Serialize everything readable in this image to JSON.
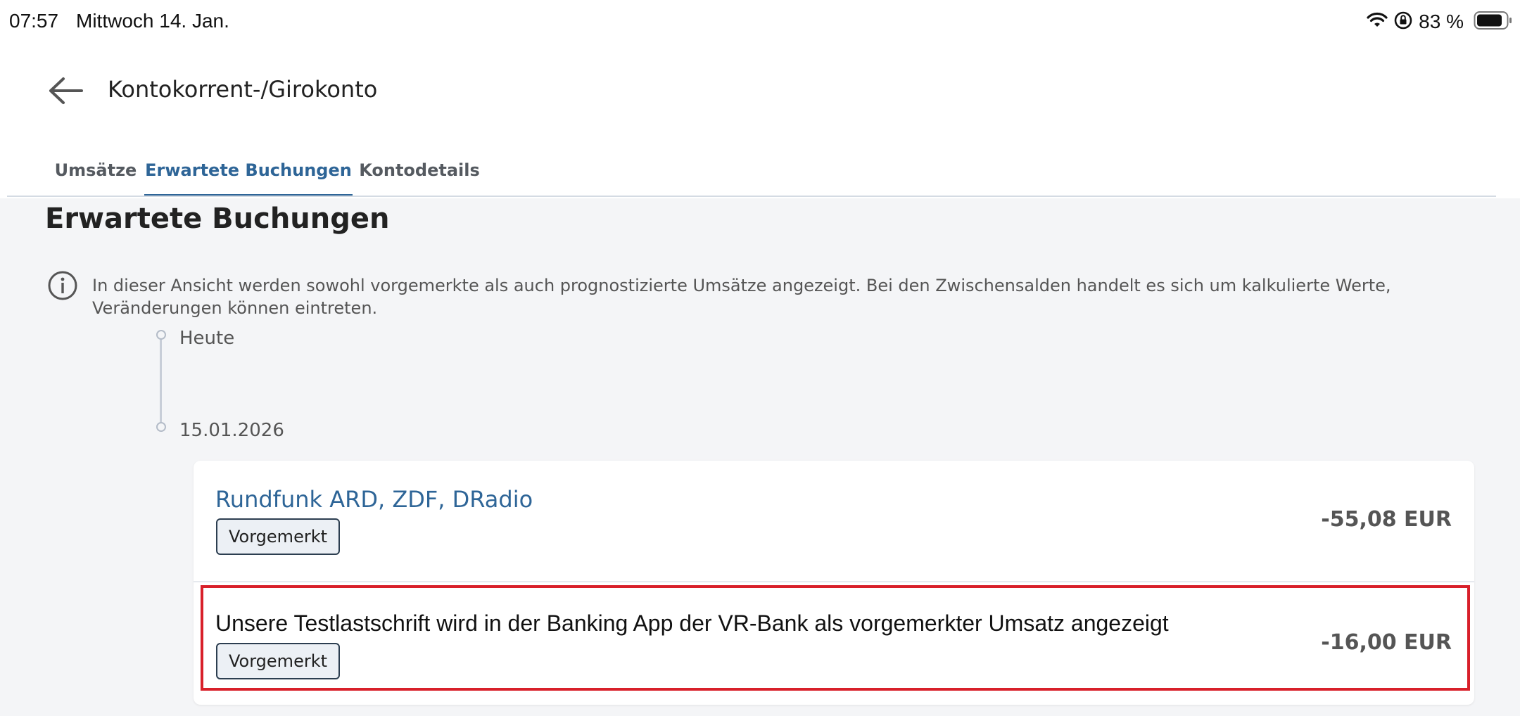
{
  "status_bar": {
    "time": "07:57",
    "date": "Mittwoch 14. Jan.",
    "battery_percent": "83 %",
    "icons": [
      "wifi-icon",
      "orientation-lock-icon",
      "battery-icon"
    ]
  },
  "header": {
    "title": "Kontokorrent-/Girokonto",
    "back_icon": "arrow-left-icon"
  },
  "tabs": [
    {
      "label": "Umsätze",
      "active": false
    },
    {
      "label": "Erwartete Buchungen",
      "active": true
    },
    {
      "label": "Kontodetails",
      "active": false
    }
  ],
  "main": {
    "section_title": "Erwartete Buchungen",
    "info_text": "In dieser Ansicht werden sowohl vorgemerkte als auch prognostizierte Umsätze angezeigt. Bei den Zwischensalden handelt es sich um kalkulierte Werte, Veränderungen können eintreten.",
    "timeline": [
      "Heute",
      "15.01.2026"
    ],
    "bookings": [
      {
        "name": "Rundfunk ARD, ZDF, DRadio",
        "status": "Vorgemerkt",
        "amount": "-55,08 EUR"
      },
      {
        "name": "Unsere Testlastschrift wird in der Banking App der VR-Bank als vorgemerkter Umsatz angezeigt",
        "status": "Vorgemerkt",
        "amount": "-16,00 EUR",
        "highlighted": true
      }
    ]
  },
  "colors": {
    "accent": "#2e6597",
    "highlight": "#d8202a",
    "background": "#f4f5f7"
  }
}
